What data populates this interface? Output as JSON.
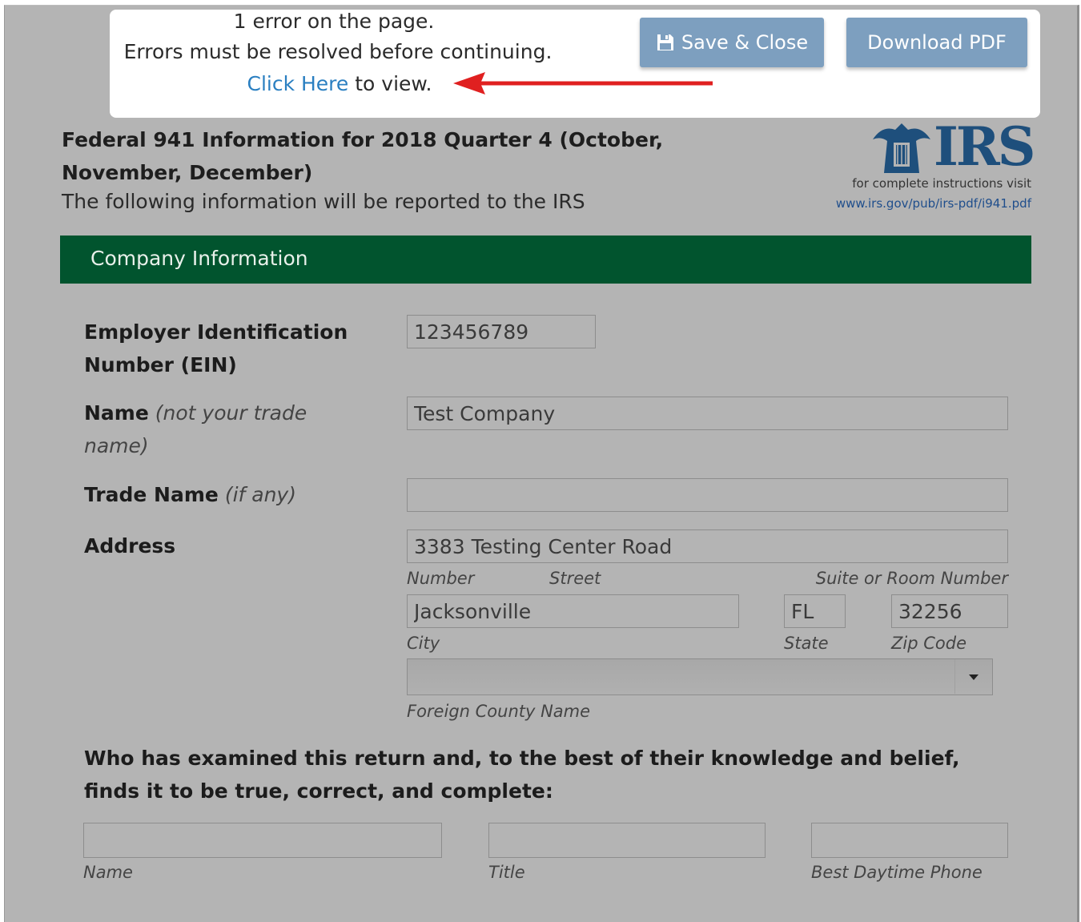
{
  "banner": {
    "line1": "1 error on the page.",
    "line2": "Errors must be resolved before continuing.",
    "link_text": "Click Here",
    "line3_tail": " to view.",
    "save_close_label": "Save & Close",
    "download_pdf_label": "Download PDF"
  },
  "header": {
    "title": "Federal 941 Information for 2018 Quarter 4 (October, November, December)",
    "subtitle": "The following information will be reported to the IRS"
  },
  "irs": {
    "wordmark": "IRS",
    "note": "for complete instructions visit",
    "url": "www.irs.gov/pub/irs-pdf/i941.pdf"
  },
  "section": {
    "title": "Company Information"
  },
  "form": {
    "ein_label": "Employer Identification Number (EIN)",
    "ein_value": "123456789",
    "name_label": "Name",
    "name_hint": "(not your trade name)",
    "name_value": "Test Company",
    "trade_label": "Trade Name",
    "trade_hint": "(if any)",
    "trade_value": "",
    "address_label": "Address",
    "address_value": "3383 Testing Center Road",
    "number_hint": "Number",
    "street_hint": "Street",
    "suite_hint": "Suite or Room Number",
    "city_value": "Jacksonville",
    "state_value": "FL",
    "zip_value": "32256",
    "city_hint": "City",
    "state_hint": "State",
    "zip_hint": "Zip Code",
    "foreign_hint": "Foreign County Name",
    "examined_label": "Who has examined this return and, to the best of their knowledge and belief, finds it to be true, correct, and complete:",
    "signer_name_hint": "Name",
    "signer_title_hint": "Title",
    "signer_phone_hint": "Best Daytime Phone"
  }
}
